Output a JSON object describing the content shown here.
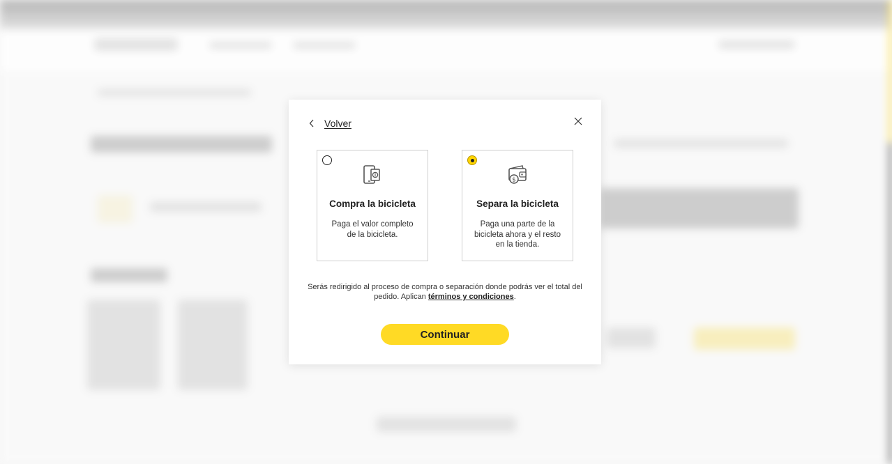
{
  "modal": {
    "back_label": "Volver",
    "options": [
      {
        "title": "Compra la bicicleta",
        "description": "Paga el valor completo de la bicicleta.",
        "selected": false,
        "icon": "phone-payment-icon"
      },
      {
        "title": "Separa la bicicleta",
        "description": "Paga una parte de la bicicleta ahora y el resto en la tienda.",
        "selected": true,
        "icon": "wallet-coin-icon"
      }
    ],
    "notice_text": "Serás redirigido al proceso de compra o separación donde podrás ver el total del pedido. Aplican ",
    "terms_link": "términos y condiciones",
    "notice_end": ".",
    "continue_label": "Continuar"
  },
  "colors": {
    "accent": "#FFDA25",
    "text": "#222222",
    "border": "#CFCFCF"
  }
}
